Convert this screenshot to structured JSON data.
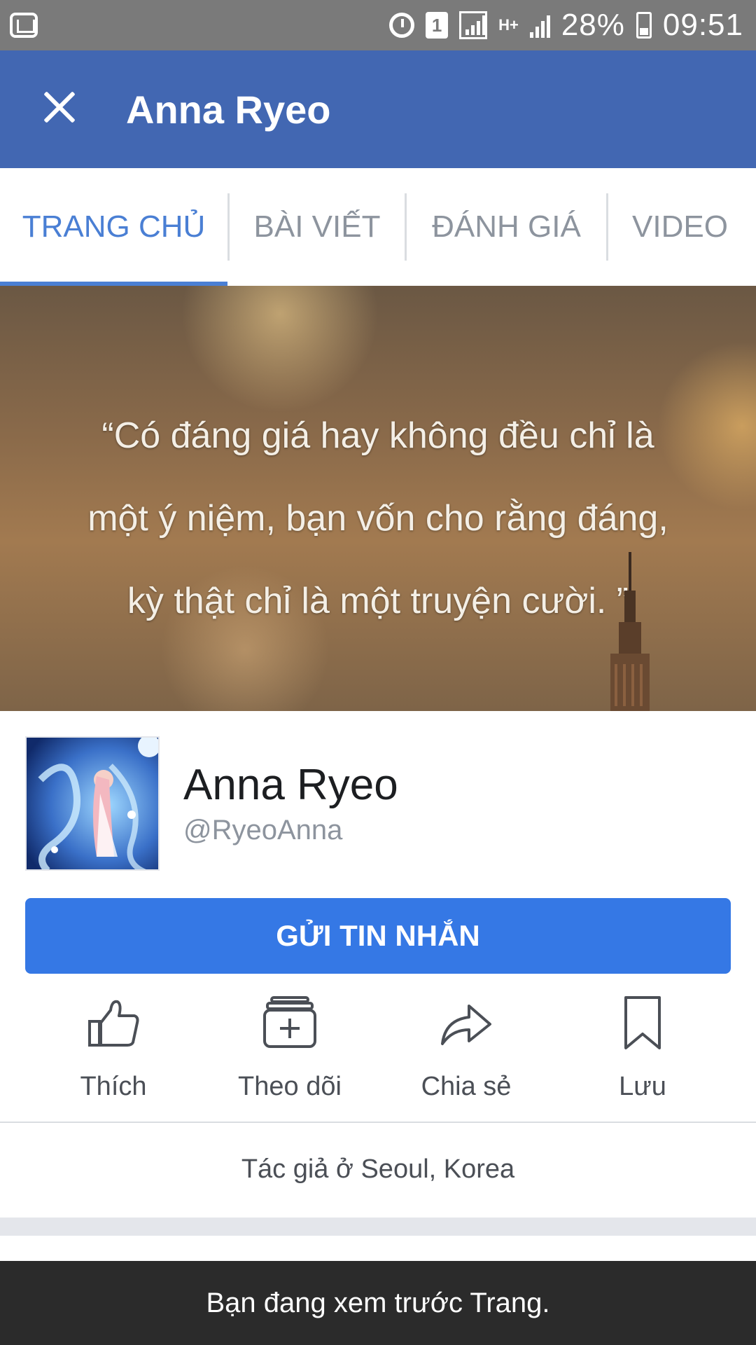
{
  "status_bar": {
    "battery_percent": "28%",
    "time": "09:51",
    "sim_slot": "1",
    "network": "H+"
  },
  "header": {
    "title": "Anna Ryeo",
    "background_color": "#4267b2"
  },
  "tabs": [
    {
      "label": "TRANG CHỦ",
      "active": true
    },
    {
      "label": "BÀI VIẾT",
      "active": false
    },
    {
      "label": "ĐÁNH GIÁ",
      "active": false
    },
    {
      "label": "VIDEO",
      "active": false
    }
  ],
  "cover": {
    "quote_lines": [
      "“Có đáng giá hay không đều chỉ là",
      "một ý niệm, bạn vốn cho rằng đáng,",
      "kỳ thật chỉ là một truyện cười. ”"
    ]
  },
  "profile": {
    "name": "Anna Ryeo",
    "handle": "@RyeoAnna"
  },
  "message_button": {
    "label": "GỬI TIN NHẮN",
    "color": "#3578e5"
  },
  "actions": [
    {
      "label": "Thích",
      "icon": "thumbs-up-icon"
    },
    {
      "label": "Theo dõi",
      "icon": "follow-icon"
    },
    {
      "label": "Chia sẻ",
      "icon": "share-icon"
    },
    {
      "label": "Lưu",
      "icon": "bookmark-icon"
    }
  ],
  "about": {
    "text": "Tác giả ở Seoul, Korea"
  },
  "preview_banner": {
    "text": "Bạn đang xem trước Trang."
  }
}
